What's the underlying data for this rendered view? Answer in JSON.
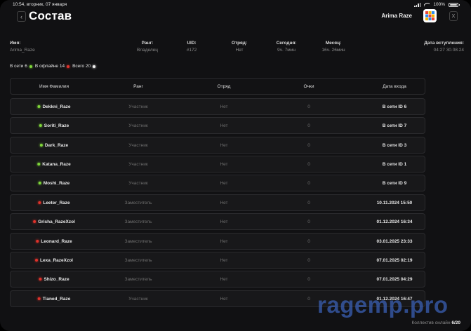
{
  "status_bar": {
    "time": "10:54, вторник, 07 января",
    "battery": "100%"
  },
  "header": {
    "back_icon": "chevron-left-icon",
    "title": "Состав",
    "user_name": "Arima Raze",
    "close_label": "X"
  },
  "info": {
    "name_label": "Имя:",
    "name_value": "Arima_Raze",
    "rank_label": "Ранг:",
    "rank_value": "Владелец",
    "uid_label": "UID:",
    "uid_value": "#172",
    "squad_label": "Отряд:",
    "squad_value": "Нет",
    "today_label": "Сегодня:",
    "today_value": "9ч. 7мин",
    "month_label": "Месяц:",
    "month_value": "16ч. 26мин",
    "joined_label": "Дата вступления:",
    "joined_value": "04:27 30.08.24"
  },
  "counters": {
    "online": "В сети 6",
    "offline": "В офлайне 14",
    "total": "Всего 20"
  },
  "table": {
    "headers": {
      "name": "Имя Фамилия",
      "rank": "Ранг",
      "squad": "Отряд",
      "points": "Очки",
      "date": "Дата входа"
    },
    "rows": [
      {
        "status": "online",
        "name": "Dekkni_Raze",
        "rank": "Участник",
        "squad": "Нет",
        "points": "0",
        "date": "В сети ID 6"
      },
      {
        "status": "online",
        "name": "Soriti_Raze",
        "rank": "Участник",
        "squad": "Нет",
        "points": "0",
        "date": "В сети ID 7"
      },
      {
        "status": "online",
        "name": "Dark_Raze",
        "rank": "Участник",
        "squad": "Нет",
        "points": "0",
        "date": "В сети ID 3"
      },
      {
        "status": "online",
        "name": "Katana_Raze",
        "rank": "Участник",
        "squad": "Нет",
        "points": "0",
        "date": "В сети ID 1"
      },
      {
        "status": "online",
        "name": "Moshi_Raze",
        "rank": "Участник",
        "squad": "Нет",
        "points": "0",
        "date": "В сети ID 9"
      },
      {
        "status": "offline",
        "name": "Leeter_Raze",
        "rank": "Заместитель",
        "squad": "Нет",
        "points": "0",
        "date": "10.11.2024 15:50"
      },
      {
        "status": "offline",
        "name": "Grisha_RazeXzol",
        "rank": "Заместитель",
        "squad": "Нет",
        "points": "0",
        "date": "01.12.2024 16:34"
      },
      {
        "status": "offline",
        "name": "Leonard_Raze",
        "rank": "Заместитель",
        "squad": "Нет",
        "points": "0",
        "date": "03.01.2025 23:33"
      },
      {
        "status": "offline",
        "name": "Lexa_RazeXzol",
        "rank": "Заместитель",
        "squad": "Нет",
        "points": "0",
        "date": "07.01.2025 02:19"
      },
      {
        "status": "offline",
        "name": "Shizo_Raze",
        "rank": "Заместитель",
        "squad": "Нет",
        "points": "0",
        "date": "07.01.2025 04:29"
      },
      {
        "status": "offline",
        "name": "Tianed_Raze",
        "rank": "Участник",
        "squad": "Нет",
        "points": "0",
        "date": "01.12.2024 16:47"
      }
    ]
  },
  "watermark": "ragemp.pro",
  "footer": {
    "label": "Коллектив онлайн",
    "count": "6/20"
  },
  "colors": {
    "online": "#7fd63a",
    "offline": "#e0322b",
    "background": "#111113",
    "row": "#18181a"
  }
}
